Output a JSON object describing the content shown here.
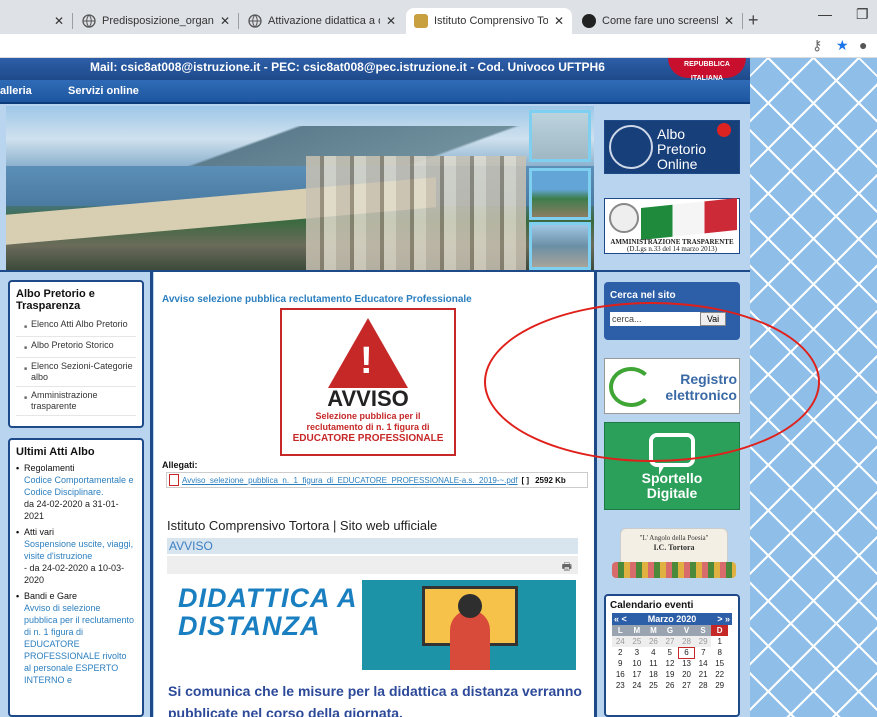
{
  "browser": {
    "tabs": [
      {
        "title": "",
        "active": false
      },
      {
        "title": "Predisposizione_organizzative_pe",
        "active": false
      },
      {
        "title": "Attivazione didattica a distanza.p",
        "active": false
      },
      {
        "title": "Istituto Comprensivo Tortora | Sit",
        "active": true
      },
      {
        "title": "Come fare uno screenshot Windo",
        "active": false
      }
    ],
    "new_tab": "+",
    "minimize": "—",
    "restore": "❐",
    "key_icon": "key-icon",
    "star_icon": "star-icon",
    "account_icon": "account-icon"
  },
  "site": {
    "header_mail": "Mail: csic8at008@istruzione.it - PEC: csic8at008@pec.istruzione.it - Cod. Univoco UFTPH6",
    "badge": "REPUBBLICA ITALIANA",
    "nav": [
      "alleria",
      "Servizi online"
    ],
    "albo_online": "Albo\nPretorio\nOnline",
    "amministrazione": "AMMINISTRAZIONE TRASPARENTE",
    "amministrazione_sub": "(D.Lgs n.33 del 14 marzo 2013)"
  },
  "left": {
    "albo_title": "Albo Pretorio e Trasparenza",
    "albo_items": [
      "Elenco Atti Albo Pretorio",
      "Albo Pretorio Storico",
      "Elenco Sezioni-Categorie albo",
      "Amministrazione trasparente"
    ],
    "atti_title": "Ultimi Atti Albo",
    "atti": [
      {
        "cat": "Regolamenti",
        "link": "Codice Comportamentale e Codice Disciplinare.",
        "date": "da 24-02-2020 a 31-01-2021"
      },
      {
        "cat": "Atti vari",
        "link": "Sospensione uscite, viaggi, visite d'istruzione",
        "date": "- da 24-02-2020 a 10-03-2020"
      },
      {
        "cat": "Bandi e Gare",
        "link": "Avviso di selezione pubblica per il reclutamento di n. 1 figura di EDUCATORE PROFESSIONALE rivolto al personale ESPERTO INTERNO e",
        "date": ""
      }
    ]
  },
  "main": {
    "headline": "Avviso selezione pubblica reclutamento Educatore Professionale",
    "avviso_big": "AVVISO",
    "avviso_small1": "Selezione pubblica per il reclutamento di n. 1 figura di",
    "avviso_small2": "EDUCATORE PROFESSIONALE",
    "allegati_label": "Allegati:",
    "allegato_name": "Avviso_selezione_pubblica_n._1_figura_di_EDUCATORE_PROFESSIONALE-a.s._2019-~.pdf",
    "allegato_brackets": "[ ]",
    "allegato_size": "2592 Kb",
    "iframe_title": "Istituto Comprensivo Tortora | Sito web ufficiale",
    "iframe_bar": "AVVISO",
    "dad_line1": "DIDATTICA A",
    "dad_line2": "DISTANZA",
    "message": "Si comunica che le misure per la didattica a distanza verranno pubblicate nel corso della giornata,"
  },
  "right": {
    "cerca_title": "Cerca nel sito",
    "cerca_placeholder": "cerca...",
    "cerca_button": "Vai",
    "registro": "Registro\nelettronico",
    "sportello": "Sportello\nDigitale",
    "poesia_title": "\"L' Angolo della Poesia\"",
    "poesia_sub": "I.C. Tortora",
    "cal_title": "Calendario eventi",
    "cal_month": "Marzo 2020",
    "cal_prev": "« <",
    "cal_next": "> »",
    "cal_dow": [
      "L",
      "M",
      "M",
      "G",
      "V",
      "S",
      "D"
    ],
    "cal_rows": [
      [
        "24",
        "25",
        "26",
        "27",
        "28",
        "29",
        "1"
      ],
      [
        "2",
        "3",
        "4",
        "5",
        "6",
        "7",
        "8"
      ],
      [
        "9",
        "10",
        "11",
        "12",
        "13",
        "14",
        "15"
      ],
      [
        "16",
        "17",
        "18",
        "19",
        "20",
        "21",
        "22"
      ],
      [
        "23",
        "24",
        "25",
        "26",
        "27",
        "28",
        "29"
      ]
    ],
    "cal_today": "6"
  }
}
